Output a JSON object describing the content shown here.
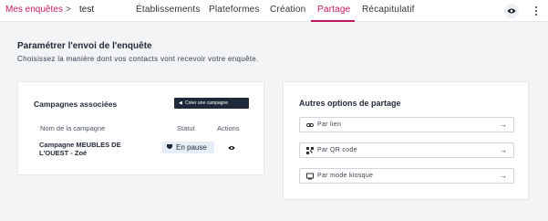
{
  "breadcrumb": {
    "parent": "Mes enquêtes",
    "separator": ">",
    "current": "test"
  },
  "tabs": [
    {
      "label": "Établissements"
    },
    {
      "label": "Plateformes"
    },
    {
      "label": "Création"
    },
    {
      "label": "Partage",
      "active": true
    },
    {
      "label": "Récapitulatif"
    }
  ],
  "header_actions": {
    "preview_icon": "eye-icon",
    "menu_icon": "kebab-icon"
  },
  "page": {
    "title": "Paramétrer l'envoi de l'enquête",
    "subtitle": "Choisissez la manière dont vos contacts vont recevoir votre enquête."
  },
  "campaigns": {
    "title": "Campagnes associées",
    "create_label": "Créer une campagne",
    "columns": [
      "Nom de la campagne",
      "Statut",
      "Actions"
    ],
    "rows": [
      {
        "name": "Campagne MEUBLES DE L'OUEST - Zoé",
        "status": "En pause"
      }
    ]
  },
  "share_options": {
    "title": "Autres options de partage",
    "items": [
      {
        "label": "Par lien",
        "icon": "link-icon"
      },
      {
        "label": "Par QR code",
        "icon": "qr-code-icon"
      },
      {
        "label": "Par mode kiosque",
        "icon": "kiosk-icon"
      }
    ]
  },
  "colors": {
    "accent": "#c2185b",
    "dark_button": "#1e2a3a",
    "badge_bg": "#e5eef7"
  }
}
